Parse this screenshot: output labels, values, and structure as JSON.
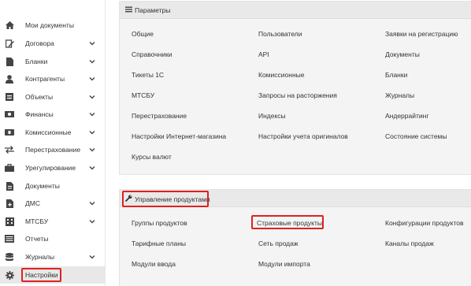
{
  "sidebar": {
    "items": [
      {
        "icon": "home-icon",
        "label": "Мои документы",
        "chevron": false
      },
      {
        "icon": "contract-icon",
        "label": "Договора",
        "chevron": true
      },
      {
        "icon": "blank-form-icon",
        "label": "Бланки",
        "chevron": true
      },
      {
        "icon": "user-icon",
        "label": "Контрагенты",
        "chevron": true
      },
      {
        "icon": "object-icon",
        "label": "Объекты",
        "chevron": true
      },
      {
        "icon": "money-icon",
        "label": "Финансы",
        "chevron": true
      },
      {
        "icon": "commission-icon",
        "label": "Комиссионные",
        "chevron": true
      },
      {
        "icon": "exchange-icon",
        "label": "Перестрахование",
        "chevron": true
      },
      {
        "icon": "briefcase-icon",
        "label": "Урегулирование",
        "chevron": true
      },
      {
        "icon": "document-icon",
        "label": "Документы",
        "chevron": false
      },
      {
        "icon": "dms-icon",
        "label": "ДМС",
        "chevron": true
      },
      {
        "icon": "building-icon",
        "label": "МТСБУ",
        "chevron": true
      },
      {
        "icon": "report-icon",
        "label": "Отчеты",
        "chevron": false
      },
      {
        "icon": "database-icon",
        "label": "Журналы",
        "chevron": true
      },
      {
        "icon": "gear-icon",
        "label": "Настройки",
        "chevron": false
      }
    ]
  },
  "params_panel": {
    "title": "Параметры",
    "links": [
      "Общие",
      "Пользователи",
      "Заявки на регистрацию",
      "Справочники",
      "API",
      "Документы",
      "Тикеты 1С",
      "Комиссионные",
      "Бланки",
      "МТСБУ",
      "Запросы на расторжения",
      "Журналы",
      "Перестрахование",
      "Индексы",
      "Андеррайтинг",
      "Настройки Интернет-магазина",
      "Настройки учета оригиналов",
      "Состояние системы",
      "Курсы валют"
    ]
  },
  "products_panel": {
    "title": "Управление продуктами",
    "links": [
      "Группы продуктов",
      "Страховые продукты",
      "Конфигурации продуктов",
      "Тарифные планы",
      "Сеть продаж",
      "Каналы продаж",
      "Модули ввода",
      "Модули импорта"
    ]
  },
  "colors": {
    "highlight": "#e02020",
    "panel_bg": "#f4f4f4",
    "panel_head_bg": "#e9e9e9",
    "active_item_bg": "#e8e8e8"
  }
}
